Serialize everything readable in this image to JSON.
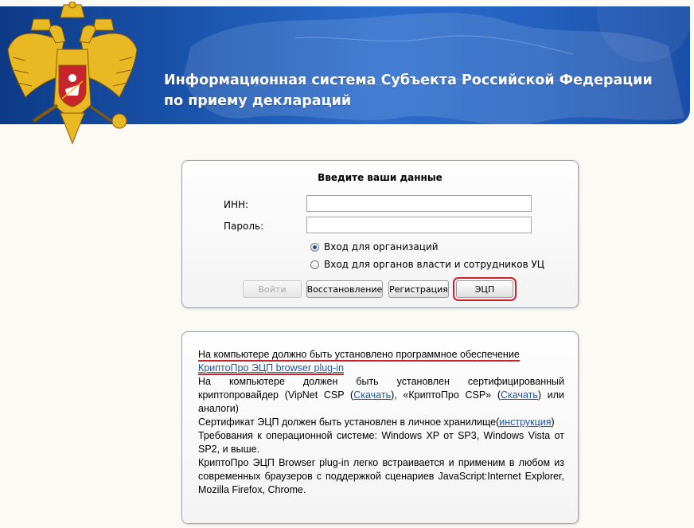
{
  "header": {
    "title_line1": "Информационная система Субъекта Российской Федерации",
    "title_line2": "по приему деклараций",
    "emblem_icon": "russian-coat-of-arms-icon"
  },
  "login": {
    "heading": "Введите ваши данные",
    "inn_label": "ИНН:",
    "inn_value": "",
    "password_label": "Пароль:",
    "password_value": "",
    "radio_options": [
      {
        "label": "Вход для организаций",
        "selected": true
      },
      {
        "label": "Вход для органов власти и сотрудников УЦ",
        "selected": false
      }
    ],
    "buttons": {
      "login": "Войти",
      "restore": "Восстановление",
      "register": "Регистрация",
      "ecp": "ЭЦП"
    }
  },
  "info": {
    "line1": "На компьютере должно быть установлено программное обеспечение",
    "plugin_link": "КриптоПро ЭЦП browser plug-in",
    "p2_part1": "На компьютере должен быть установлен сертифицированный криптопровайдер (VipNet CSP (",
    "p2_link1": "Скачать",
    "p2_part2": "), «КриптоПро CSP» (",
    "p2_link2": "Скачать",
    "p2_part3": ") или аналоги)",
    "p3_part1": "Сертификат ЭЦП должен быть установлен в личное хранилище(",
    "p3_link": "инструкция",
    "p3_part2": ")",
    "p4": "Требования к операционной системе: Windows XP от SP3, Windows Vista от SP2, и выше.",
    "p5": "КриптоПро ЭЦП Browser plug-in легко встраивается и применим в любом из современных браузеров с поддержкой сценариев JavaScript:Internet Explorer, Mozilla Firefox, Chrome."
  },
  "colors": {
    "banner_blue": "#1c56b0",
    "highlight_red": "#c8242c",
    "link_blue": "#1e56a6"
  }
}
